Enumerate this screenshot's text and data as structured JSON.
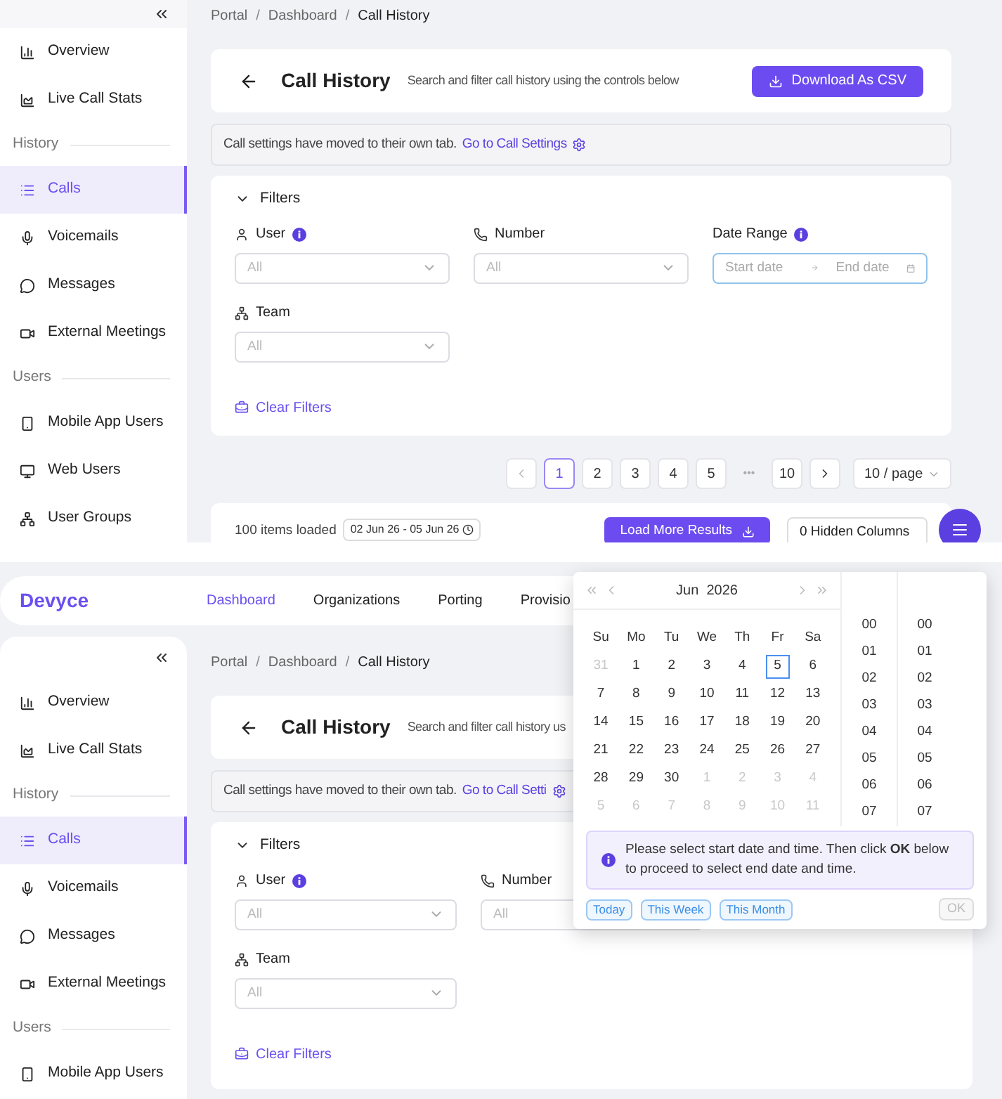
{
  "screens": [
    {
      "sidebar": {
        "items": [
          {
            "kind": "item",
            "label": "Overview",
            "selected": false
          },
          {
            "kind": "item",
            "label": "Live Call Stats",
            "selected": false
          },
          {
            "kind": "section",
            "label": "History"
          },
          {
            "kind": "item",
            "label": "Calls",
            "selected": true
          },
          {
            "kind": "item",
            "label": "Voicemails",
            "selected": false
          },
          {
            "kind": "item",
            "label": "Messages",
            "selected": false
          },
          {
            "kind": "item",
            "label": "External Meetings",
            "selected": false
          },
          {
            "kind": "section",
            "label": "Users"
          },
          {
            "kind": "item",
            "label": "Mobile App Users",
            "selected": false
          },
          {
            "kind": "item",
            "label": "Web Users",
            "selected": false
          },
          {
            "kind": "item",
            "label": "User Groups",
            "selected": false
          }
        ]
      },
      "breadcrumb": {
        "separator": "/",
        "parts": [
          "Portal",
          "Dashboard",
          "Call History"
        ]
      },
      "header": {
        "title": "Call History",
        "subtitle": "Search and filter call history using the controls below",
        "button": "Download As CSV"
      },
      "notice": {
        "text": "Call settings have moved to their own tab.",
        "link": "Go to Call Settings"
      },
      "filters": {
        "title": "Filters",
        "expanded": true,
        "clear": "Clear Filters",
        "fields": [
          {
            "kind": "user",
            "label": "User",
            "info": true,
            "placeholder": "All"
          },
          {
            "kind": "number",
            "label": "Number",
            "info": false,
            "placeholder": "All"
          },
          {
            "kind": "date_range",
            "label": "Date Range",
            "info": true,
            "start_placeholder": "Start date",
            "end_placeholder": "End date",
            "focused": true
          },
          {
            "kind": "team",
            "label": "Team",
            "info": false,
            "placeholder": "All"
          }
        ]
      },
      "pagination": {
        "page_size": "10 / page",
        "pages": [
          {
            "kind": "prev"
          },
          {
            "kind": "page",
            "label": "1",
            "selected": true
          },
          {
            "kind": "page",
            "label": "2",
            "selected": false
          },
          {
            "kind": "page",
            "label": "3",
            "selected": false
          },
          {
            "kind": "page",
            "label": "4",
            "selected": false
          },
          {
            "kind": "page",
            "label": "5",
            "selected": false
          },
          {
            "kind": "ellipsis",
            "label": "•••"
          },
          {
            "kind": "page",
            "label": "10",
            "selected": false
          },
          {
            "kind": "next"
          }
        ]
      },
      "results_bar": {
        "loaded": "100 items loaded",
        "range": "02 Jun 26 - 05 Jun 26",
        "load_more": "Load More Results",
        "hidden_columns": "0 Hidden Columns"
      }
    },
    {
      "nav": {
        "logo": "Devyce",
        "items": [
          {
            "label": "Dashboard",
            "selected": true
          },
          {
            "label": "Organizations",
            "selected": false
          },
          {
            "label": "Porting",
            "selected": false
          },
          {
            "label": "Provisio",
            "selected": false
          }
        ]
      },
      "sidebar": {
        "items": [
          {
            "kind": "item",
            "label": "Overview",
            "selected": false
          },
          {
            "kind": "item",
            "label": "Live Call Stats",
            "selected": false
          },
          {
            "kind": "section",
            "label": "History"
          },
          {
            "kind": "item",
            "label": "Calls",
            "selected": true
          },
          {
            "kind": "item",
            "label": "Voicemails",
            "selected": false
          },
          {
            "kind": "item",
            "label": "Messages",
            "selected": false
          },
          {
            "kind": "item",
            "label": "External Meetings",
            "selected": false
          },
          {
            "kind": "section",
            "label": "Users"
          },
          {
            "kind": "item",
            "label": "Mobile App Users",
            "selected": false
          }
        ]
      },
      "breadcrumb": {
        "separator": "/",
        "parts": [
          "Portal",
          "Dashboard",
          "Call History"
        ]
      },
      "header": {
        "title": "Call History",
        "subtitle": "Search and filter call history us"
      },
      "notice": {
        "text": "Call settings have moved to their own tab.",
        "link": "Go to Call Setti"
      },
      "filters": {
        "title": "Filters",
        "expanded": true,
        "clear": "Clear Filters",
        "fields": [
          {
            "kind": "user",
            "label": "User",
            "info": true,
            "placeholder": "All"
          },
          {
            "kind": "number",
            "label": "Number",
            "info": false,
            "placeholder": "All"
          },
          {
            "kind": "team",
            "label": "Team",
            "info": false,
            "placeholder": "All"
          }
        ]
      },
      "date_picker": {
        "month": "Jun  2026",
        "weekdays": [
          "Su",
          "Mo",
          "Tu",
          "We",
          "Th",
          "Fr",
          "Sa"
        ],
        "days": [
          {
            "label": "31",
            "muted": true,
            "today": false
          },
          {
            "label": "1",
            "muted": false,
            "today": false
          },
          {
            "label": "2",
            "muted": false,
            "today": false
          },
          {
            "label": "3",
            "muted": false,
            "today": false
          },
          {
            "label": "4",
            "muted": false,
            "today": false
          },
          {
            "label": "5",
            "muted": false,
            "today": true
          },
          {
            "label": "6",
            "muted": false,
            "today": false
          },
          {
            "label": "7",
            "muted": false,
            "today": false
          },
          {
            "label": "8",
            "muted": false,
            "today": false
          },
          {
            "label": "9",
            "muted": false,
            "today": false
          },
          {
            "label": "10",
            "muted": false,
            "today": false
          },
          {
            "label": "11",
            "muted": false,
            "today": false
          },
          {
            "label": "12",
            "muted": false,
            "today": false
          },
          {
            "label": "13",
            "muted": false,
            "today": false
          },
          {
            "label": "14",
            "muted": false,
            "today": false
          },
          {
            "label": "15",
            "muted": false,
            "today": false
          },
          {
            "label": "16",
            "muted": false,
            "today": false
          },
          {
            "label": "17",
            "muted": false,
            "today": false
          },
          {
            "label": "18",
            "muted": false,
            "today": false
          },
          {
            "label": "19",
            "muted": false,
            "today": false
          },
          {
            "label": "20",
            "muted": false,
            "today": false
          },
          {
            "label": "21",
            "muted": false,
            "today": false
          },
          {
            "label": "22",
            "muted": false,
            "today": false
          },
          {
            "label": "23",
            "muted": false,
            "today": false
          },
          {
            "label": "24",
            "muted": false,
            "today": false
          },
          {
            "label": "25",
            "muted": false,
            "today": false
          },
          {
            "label": "26",
            "muted": false,
            "today": false
          },
          {
            "label": "27",
            "muted": false,
            "today": false
          },
          {
            "label": "28",
            "muted": false,
            "today": false
          },
          {
            "label": "29",
            "muted": false,
            "today": false
          },
          {
            "label": "30",
            "muted": false,
            "today": false
          },
          {
            "label": "1",
            "muted": true,
            "today": false
          },
          {
            "label": "2",
            "muted": true,
            "today": false
          },
          {
            "label": "3",
            "muted": true,
            "today": false
          },
          {
            "label": "4",
            "muted": true,
            "today": false
          },
          {
            "label": "5",
            "muted": true,
            "today": false
          },
          {
            "label": "6",
            "muted": true,
            "today": false
          },
          {
            "label": "7",
            "muted": true,
            "today": false
          },
          {
            "label": "8",
            "muted": true,
            "today": false
          },
          {
            "label": "9",
            "muted": true,
            "today": false
          },
          {
            "label": "10",
            "muted": true,
            "today": false
          },
          {
            "label": "11",
            "muted": true,
            "today": false
          }
        ],
        "hours": [
          "00",
          "01",
          "02",
          "03",
          "04",
          "05",
          "06",
          "07"
        ],
        "minutes": [
          "00",
          "01",
          "02",
          "03",
          "04",
          "05",
          "06",
          "07"
        ],
        "info": "Please select start date and time. Then click **OK** below to proceed to select end date and time.",
        "presets": [
          "Today",
          "This Week",
          "This Month"
        ],
        "ok": {
          "label": "OK",
          "disabled": true
        }
      }
    }
  ]
}
